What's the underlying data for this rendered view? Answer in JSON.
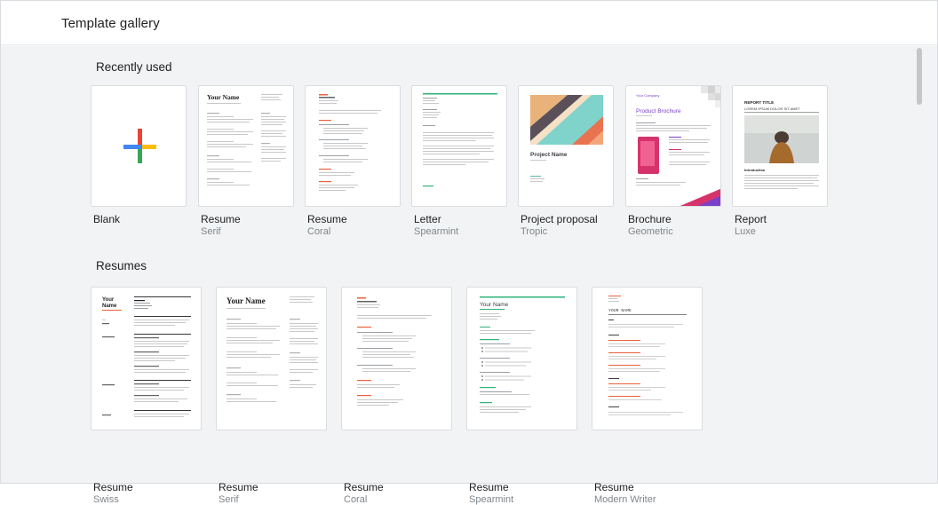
{
  "header": {
    "title": "Template gallery"
  },
  "sections": {
    "recent": {
      "title": "Recently used",
      "tiles": [
        {
          "name": "Blank",
          "subtitle": ""
        },
        {
          "name": "Resume",
          "subtitle": "Serif"
        },
        {
          "name": "Resume",
          "subtitle": "Coral"
        },
        {
          "name": "Letter",
          "subtitle": "Spearmint"
        },
        {
          "name": "Project proposal",
          "subtitle": "Tropic"
        },
        {
          "name": "Brochure",
          "subtitle": "Geometric"
        },
        {
          "name": "Report",
          "subtitle": "Luxe"
        }
      ]
    },
    "resumes": {
      "title": "Resumes",
      "tiles": [
        {
          "name": "Resume",
          "subtitle": "Swiss"
        },
        {
          "name": "Resume",
          "subtitle": "Serif"
        },
        {
          "name": "Resume",
          "subtitle": "Coral"
        },
        {
          "name": "Resume",
          "subtitle": "Spearmint"
        },
        {
          "name": "Resume",
          "subtitle": "Modern Writer"
        }
      ]
    }
  },
  "thumb_text": {
    "your_name": "Your Name",
    "your_name_upper": "YOUR NAME",
    "project_name": "Project Name",
    "product_brochure": "Product Brochure",
    "your_company": "Your Company",
    "report_title": "REPORT TITLE",
    "report_subtitle": "LOREM IPSUM DOLOR SIT AMET",
    "introduction": "Introduction",
    "swiss_your": "Your",
    "swiss_name": "Name"
  },
  "colors": {
    "coral": "#e8613a",
    "spearmint": "#2fb37a",
    "brochure_purple": "#7b3fc9",
    "brochure_pink": "#d6336c",
    "blank_plus": [
      "#ea4335",
      "#4285f4",
      "#34a853",
      "#fbbc04"
    ]
  }
}
